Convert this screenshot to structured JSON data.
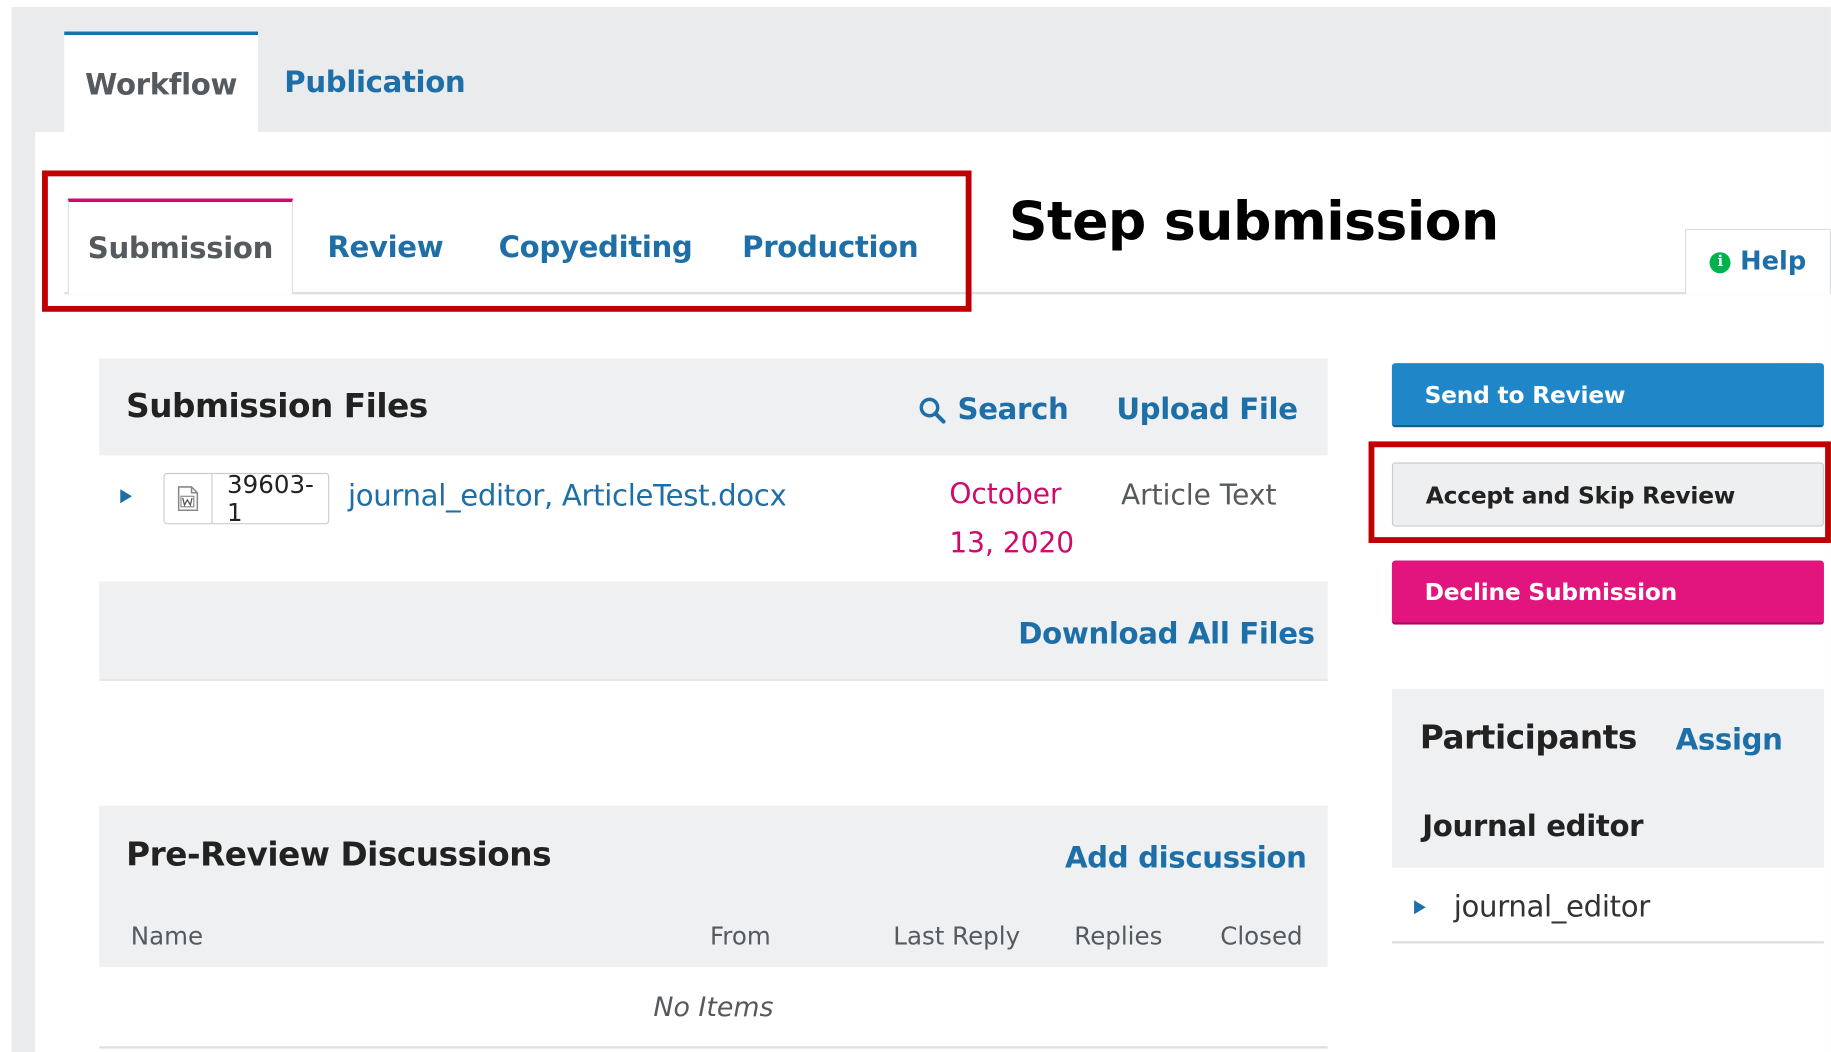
{
  "top_tabs": {
    "workflow": "Workflow",
    "publication": "Publication"
  },
  "stage_tabs": {
    "submission": "Submission",
    "review": "Review",
    "copyediting": "Copyediting",
    "production": "Production"
  },
  "annotation": {
    "step_label": "Step submission",
    "highlight_color": "#c00000"
  },
  "help": {
    "label": "Help",
    "icon": "info-icon"
  },
  "submission_files": {
    "title": "Submission Files",
    "search_label": "Search",
    "upload_label": "Upload File",
    "files": [
      {
        "id": "39603-1",
        "name": "journal_editor, ArticleTest.docx",
        "date": "October 13, 2020",
        "type": "Article Text",
        "icon": "word-document-icon"
      }
    ],
    "download_all_label": "Download All Files"
  },
  "discussions": {
    "title": "Pre-Review Discussions",
    "add_label": "Add discussion",
    "columns": [
      "Name",
      "From",
      "Last Reply",
      "Replies",
      "Closed"
    ],
    "empty_text": "No Items"
  },
  "actions": {
    "send_to_review": "Send to Review",
    "accept_skip": "Accept and Skip Review",
    "decline": "Decline Submission"
  },
  "participants": {
    "title": "Participants",
    "assign_label": "Assign",
    "role": "Journal editor",
    "users": [
      "journal_editor"
    ]
  },
  "colors": {
    "link_blue": "#1e6fa8",
    "primary_button": "#1f86c7",
    "decline_button": "#e2157e",
    "active_tab_accent": "#d00a6c",
    "date_color": "#d00a6c"
  }
}
